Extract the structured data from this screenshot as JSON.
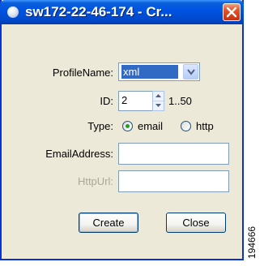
{
  "window": {
    "title": "sw172-22-46-174 - Cr..."
  },
  "form": {
    "profile_name_label": "ProfileName:",
    "profile_name_value": "xml",
    "id_label": "ID:",
    "id_value": "2",
    "id_range": "1..50",
    "type_label": "Type:",
    "type_options": [
      "email",
      "http"
    ],
    "type_selected": "email",
    "email_label": "EmailAddress:",
    "email_value": "",
    "http_label": "HttpUrl:",
    "http_value": ""
  },
  "buttons": {
    "create": "Create",
    "close": "Close"
  },
  "watermark": "194666",
  "colors": {
    "title_bar": "#0054e3",
    "window_bg": "#ece9d8",
    "selection": "#316ac5",
    "close_button": "#e3562c"
  }
}
